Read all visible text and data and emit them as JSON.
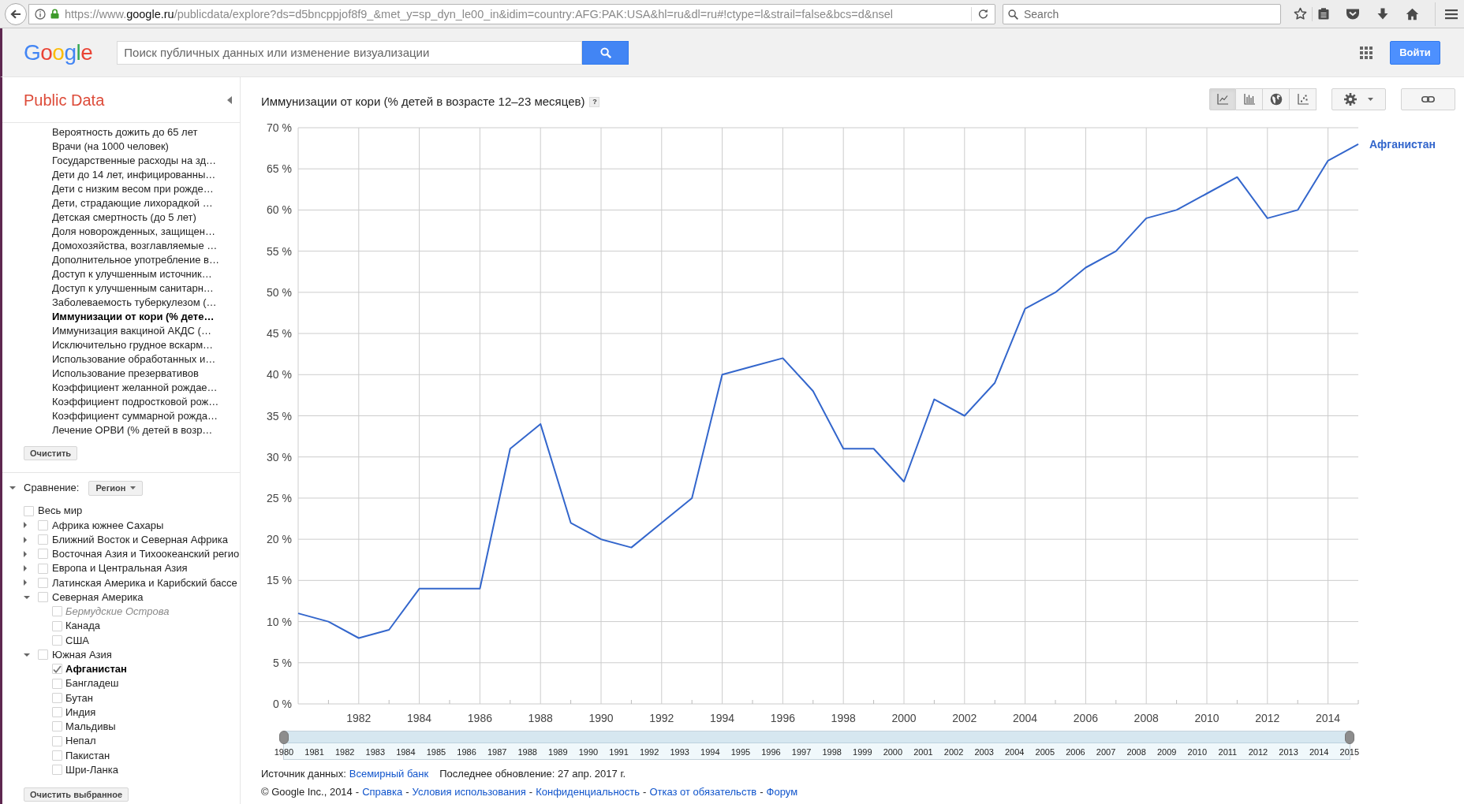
{
  "browser": {
    "url": {
      "scheme": "https://www.",
      "domain": "google.ru",
      "path": "/publicdata/explore?ds=d5bncppjof8f9_&met_y=sp_dyn_le00_in&idim=country:AFG:PAK:USA&hl=ru&dl=ru#!ctype=l&strail=false&bcs=d&nsel"
    },
    "search_placeholder": "Search"
  },
  "header": {
    "logo": "Google",
    "search_placeholder": "Поиск публичных данных или изменение визуализации",
    "sign_in": "Войти"
  },
  "sidebar": {
    "title": "Public Data",
    "indicators": [
      {
        "label": "Вероятность дожить до 65 лет",
        "selected": false
      },
      {
        "label": "Врачи (на 1000 человек)",
        "selected": false
      },
      {
        "label": "Государственные расходы на зд…",
        "selected": false
      },
      {
        "label": "Дети до 14 лет, инфицированны…",
        "selected": false
      },
      {
        "label": "Дети с низким весом при рожде…",
        "selected": false
      },
      {
        "label": "Дети, страдающие лихорадкой …",
        "selected": false
      },
      {
        "label": "Детская смертность (до 5 лет)",
        "selected": false
      },
      {
        "label": "Доля новорожденных, защищен…",
        "selected": false
      },
      {
        "label": "Домохозяйства, возглавляемые …",
        "selected": false
      },
      {
        "label": "Дополнительное употребление в…",
        "selected": false
      },
      {
        "label": "Доступ к улучшенным источник…",
        "selected": false
      },
      {
        "label": "Доступ к улучшенным санитарн…",
        "selected": false
      },
      {
        "label": "Заболеваемость туберкулезом (…",
        "selected": false
      },
      {
        "label": "Иммунизации от кори (% дете…",
        "selected": true
      },
      {
        "label": "Иммунизация вакциной АКДС (…",
        "selected": false
      },
      {
        "label": "Исключительно грудное вскарм…",
        "selected": false
      },
      {
        "label": "Использование обработанных и…",
        "selected": false
      },
      {
        "label": "Использование презервативов",
        "selected": false
      },
      {
        "label": "Коэффициент желанной рождае…",
        "selected": false
      },
      {
        "label": "Коэффициент подростковой рож…",
        "selected": false
      },
      {
        "label": "Коэффициент суммарной рожда…",
        "selected": false
      },
      {
        "label": "Лечение ОРВИ (% детей в возр…",
        "selected": false
      }
    ],
    "clear_button": "Очистить",
    "comparison": {
      "label": "Сравнение:",
      "expanded": true,
      "dropdown": "Регион",
      "items": [
        {
          "label": "Весь мир",
          "kind": "single",
          "checked": false
        },
        {
          "label": "Африка южнее Сахары",
          "kind": "group",
          "expanded": false,
          "checked": false
        },
        {
          "label": "Ближний Восток и Северная Африка",
          "kind": "group",
          "expanded": false,
          "checked": false
        },
        {
          "label": "Восточная Азия и Тихоокеанский регио",
          "kind": "group",
          "expanded": false,
          "checked": false
        },
        {
          "label": "Европа и Центральная Азия",
          "kind": "group",
          "expanded": false,
          "checked": false
        },
        {
          "label": "Латинская Америка и Карибский бассе",
          "kind": "group",
          "expanded": false,
          "checked": false
        },
        {
          "label": "Северная Америка",
          "kind": "group",
          "expanded": true,
          "checked": false,
          "children": [
            {
              "label": "Бермудские Острова",
              "checked": false,
              "disabled": true
            },
            {
              "label": "Канада",
              "checked": false,
              "disabled": false
            },
            {
              "label": "США",
              "checked": false,
              "disabled": false
            }
          ]
        },
        {
          "label": "Южная Азия",
          "kind": "group",
          "expanded": true,
          "checked": false,
          "children": [
            {
              "label": "Афганистан",
              "checked": true,
              "disabled": false
            },
            {
              "label": "Бангладеш",
              "checked": false,
              "disabled": false
            },
            {
              "label": "Бутан",
              "checked": false,
              "disabled": false
            },
            {
              "label": "Индия",
              "checked": false,
              "disabled": false
            },
            {
              "label": "Мальдивы",
              "checked": false,
              "disabled": false
            },
            {
              "label": "Непал",
              "checked": false,
              "disabled": false
            },
            {
              "label": "Пакистан",
              "checked": false,
              "disabled": false
            },
            {
              "label": "Шри-Ланка",
              "checked": false,
              "disabled": false
            }
          ]
        }
      ]
    },
    "clear_selected_button": "Очистить выбранное"
  },
  "chart_panel": {
    "help": "?",
    "chart_types": [
      {
        "kind": "line",
        "selected": true
      },
      {
        "kind": "bar",
        "selected": false
      },
      {
        "kind": "map",
        "selected": false
      },
      {
        "kind": "scatter",
        "selected": false
      }
    ],
    "chart_data": {
      "type": "line",
      "title": "Иммунизации от кори (% детей в возрасте 12–23 месяцев)",
      "grid": true,
      "x": [
        1980,
        1981,
        1982,
        1983,
        1984,
        1985,
        1986,
        1987,
        1988,
        1989,
        1990,
        1991,
        1992,
        1993,
        1994,
        1995,
        1996,
        1997,
        1998,
        1999,
        2000,
        2001,
        2002,
        2003,
        2004,
        2005,
        2006,
        2007,
        2008,
        2009,
        2010,
        2011,
        2012,
        2013,
        2014,
        2015
      ],
      "series": [
        {
          "name": "Афганистан",
          "color": "#3366cc",
          "values": [
            11,
            10,
            8,
            9,
            14,
            14,
            14,
            31,
            34,
            22,
            20,
            19,
            22,
            25,
            40,
            41,
            42,
            38,
            31,
            31,
            27,
            37,
            35,
            39,
            48,
            50,
            53,
            55,
            59,
            60,
            62,
            64,
            59,
            60,
            66,
            68
          ]
        }
      ],
      "xlim": [
        1980,
        2015
      ],
      "ylim": [
        0,
        70
      ],
      "xticks": [
        1982,
        1984,
        1986,
        1988,
        1990,
        1992,
        1994,
        1996,
        1998,
        2000,
        2002,
        2004,
        2006,
        2008,
        2010,
        2012,
        2014
      ],
      "yticks": [
        {
          "value": 0,
          "label": "0 %"
        },
        {
          "value": 5,
          "label": "5 %"
        },
        {
          "value": 10,
          "label": "10 %"
        },
        {
          "value": 15,
          "label": "15 %"
        },
        {
          "value": 20,
          "label": "20 %"
        },
        {
          "value": 25,
          "label": "25 %"
        },
        {
          "value": 30,
          "label": "30 %"
        },
        {
          "value": 35,
          "label": "35 %"
        },
        {
          "value": 40,
          "label": "40 %"
        },
        {
          "value": 45,
          "label": "45 %"
        },
        {
          "value": 50,
          "label": "50 %"
        },
        {
          "value": 55,
          "label": "55 %"
        },
        {
          "value": 60,
          "label": "60 %"
        },
        {
          "value": 65,
          "label": "65 %"
        },
        {
          "value": 70,
          "label": "70 %"
        }
      ]
    },
    "timeline": {
      "years": [
        {
          "label": "1980",
          "selected": true
        },
        {
          "label": "1981",
          "selected": true
        },
        {
          "label": "1982",
          "selected": true
        },
        {
          "label": "1983",
          "selected": true
        },
        {
          "label": "1984",
          "selected": true
        },
        {
          "label": "1985",
          "selected": true
        },
        {
          "label": "1986",
          "selected": true
        },
        {
          "label": "1987",
          "selected": true
        },
        {
          "label": "1988",
          "selected": true
        },
        {
          "label": "1989",
          "selected": true
        },
        {
          "label": "1990",
          "selected": true
        },
        {
          "label": "1991",
          "selected": true
        },
        {
          "label": "1992",
          "selected": true
        },
        {
          "label": "1993",
          "selected": true
        },
        {
          "label": "1994",
          "selected": true
        },
        {
          "label": "1995",
          "selected": true
        },
        {
          "label": "1996",
          "selected": true
        },
        {
          "label": "1997",
          "selected": true
        },
        {
          "label": "1998",
          "selected": true
        },
        {
          "label": "1999",
          "selected": true
        },
        {
          "label": "2000",
          "selected": true
        },
        {
          "label": "2001",
          "selected": true
        },
        {
          "label": "2002",
          "selected": true
        },
        {
          "label": "2003",
          "selected": true
        },
        {
          "label": "2004",
          "selected": true
        },
        {
          "label": "2005",
          "selected": true
        },
        {
          "label": "2006",
          "selected": true
        },
        {
          "label": "2007",
          "selected": true
        },
        {
          "label": "2008",
          "selected": true
        },
        {
          "label": "2009",
          "selected": true
        },
        {
          "label": "2010",
          "selected": true
        },
        {
          "label": "2011",
          "selected": true
        },
        {
          "label": "2012",
          "selected": true
        },
        {
          "label": "2013",
          "selected": true
        },
        {
          "label": "2014",
          "selected": true
        },
        {
          "label": "2015",
          "selected": true
        }
      ]
    },
    "source": {
      "label": "Источник данных:",
      "link": "Всемирный банк",
      "updated": "Последнее обновление: 27 апр. 2017 г."
    }
  },
  "footer": [
    {
      "kind": "text",
      "text": "© Google Inc., 2014"
    },
    {
      "kind": "separator",
      "text": "-"
    },
    {
      "kind": "link",
      "text": "Справка"
    },
    {
      "kind": "separator",
      "text": "-"
    },
    {
      "kind": "link",
      "text": "Условия использования"
    },
    {
      "kind": "separator",
      "text": "-"
    },
    {
      "kind": "link",
      "text": "Конфиденциальность"
    },
    {
      "kind": "separator",
      "text": "-"
    },
    {
      "kind": "link",
      "text": "Отказ от обязательств"
    },
    {
      "kind": "separator",
      "text": "-"
    },
    {
      "kind": "link",
      "text": "Форум"
    }
  ]
}
